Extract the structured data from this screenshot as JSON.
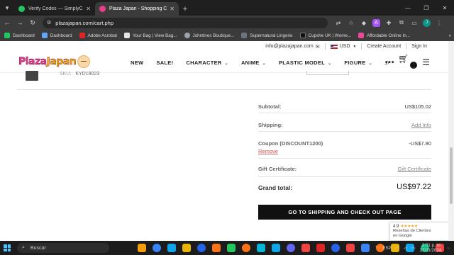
{
  "browser": {
    "tabs": [
      {
        "title": "Verify Codes — SimplyCodes",
        "favicon_color": "#22c55e",
        "active": false
      },
      {
        "title": "Plaza Japan - Shopping Cart",
        "favicon_color": "#e83e8c",
        "active": true
      }
    ],
    "url": "plazajapan.com/cart.php",
    "bookmarks": [
      {
        "label": "Dashboard",
        "color": "#22c55e"
      },
      {
        "label": "Dashboard",
        "color": "#60a5fa"
      },
      {
        "label": "Adobe Acrobat",
        "color": "#dc2626"
      },
      {
        "label": "Your Bag | View Bag...",
        "color": "#e5e5e5"
      },
      {
        "label": "Johntines Boutique...",
        "color": "#9ca3af"
      },
      {
        "label": "Supernatural Lingerie",
        "color": "#6b7280"
      },
      {
        "label": "Cupshe UK | Wome...",
        "color": "#111111"
      },
      {
        "label": "Affordable Online In...",
        "color": "#ec4899"
      }
    ],
    "profile_initial": "J",
    "extension_initial": "A"
  },
  "site": {
    "logo_text_a": "Plaza",
    "logo_text_b": "Japan",
    "email": "info@plazajapan.com",
    "currency": "USD",
    "create_account": "Create Account",
    "sign_in": "Sign In",
    "nav": [
      {
        "label": "NEW",
        "has_menu": false
      },
      {
        "label": "SALE!",
        "has_menu": false
      },
      {
        "label": "CHARACTER",
        "has_menu": true
      },
      {
        "label": "ANIME",
        "has_menu": true
      },
      {
        "label": "PLASTIC MODEL",
        "has_menu": true
      },
      {
        "label": "FIGURE",
        "has_menu": true
      }
    ],
    "more": "•••",
    "cart_count": "1"
  },
  "product": {
    "sku_label": "SKU:",
    "sku": "KYD19023"
  },
  "totals": {
    "subtotal_label": "Subtotal:",
    "subtotal_value": "US$105.02",
    "shipping_label": "Shipping:",
    "shipping_action": "Add Info",
    "coupon_label": "Coupon (DISCOUNT1200)",
    "coupon_value": "-US$7.80",
    "coupon_remove": "Remove",
    "gift_label": "Gift Certificate:",
    "gift_action": "Gift Certificate",
    "grand_label": "Grand total:",
    "grand_value": "US$97.22",
    "checkout_label": "GO TO SHIPPING AND CHECK OUT PAGE"
  },
  "review_widget": {
    "rating": "4.9",
    "stars": "★★★★★",
    "line1": "Reseñas de Clientes",
    "line2": "en Google"
  },
  "taskbar": {
    "search_placeholder": "Buscar",
    "language": "ESP",
    "time": "2:01 p. m.",
    "date": "27/11/2024",
    "app_colors": [
      "#f59e0b",
      "#3b82f6",
      "#0ea5e9",
      "#eab308",
      "#2563eb",
      "#f97316",
      "#22c55e",
      "#f97316",
      "#06b6d4",
      "#0ea5e9",
      "#6366f1",
      "#ef4444",
      "#dc2626",
      "#2563eb",
      "#ef4444",
      "#3b82f6",
      "#f97316",
      "#eab308",
      "#0ea5e9",
      "#10b981",
      "#ef4444"
    ]
  }
}
